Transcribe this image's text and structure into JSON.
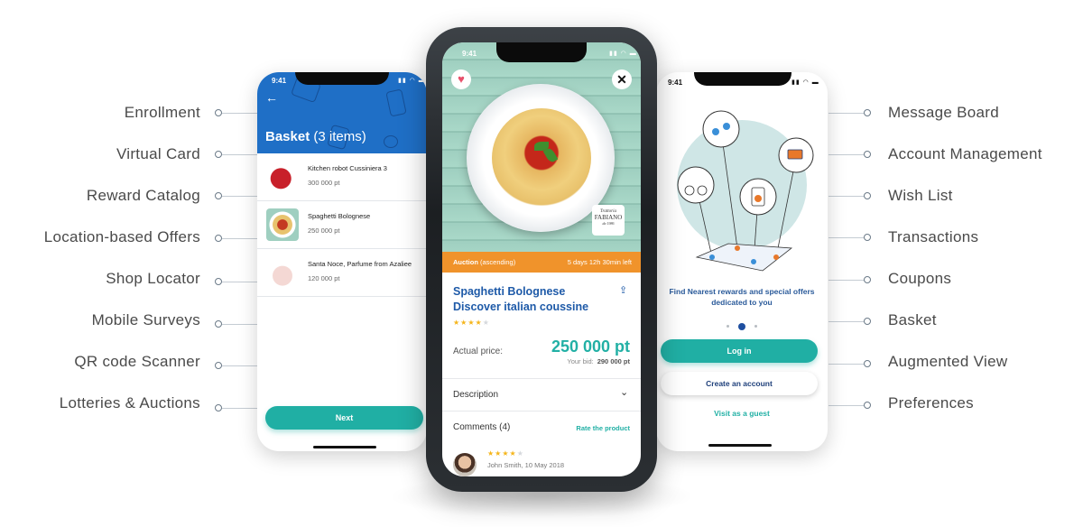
{
  "features_left": [
    "Enrollment",
    "Virtual Card",
    "Reward Catalog",
    "Location-based Offers",
    "Shop Locator",
    "Mobile Surveys",
    "QR code Scanner",
    "Lotteries & Auctions"
  ],
  "features_right": [
    "Message Board",
    "Account Management",
    "Wish List",
    "Transactions",
    "Coupons",
    "Basket",
    "Augmented View",
    "Preferences"
  ],
  "colors": {
    "primary_blue": "#1f6fc6",
    "teal": "#20afa4",
    "orange": "#f0932b",
    "title_blue": "#1e5aa8",
    "star": "#f5b51b"
  },
  "status_bar": {
    "time": "9:41",
    "icons": "signal wifi battery"
  },
  "basket_screen": {
    "back_icon": "arrow-left",
    "title": "Basket",
    "count": "(3 items)",
    "items": [
      {
        "name": "Kitchen robot Cussiniera 3",
        "price": "300 000 pt"
      },
      {
        "name": "Spaghetti Bolognese",
        "price": "250 000 pt"
      },
      {
        "name": "Santa Noce, Parfume from Azaliee",
        "price": "120 000 pt"
      }
    ],
    "next_label": "Next"
  },
  "product_screen": {
    "logo": {
      "line1": "Trattoria",
      "line2": "FABIANO",
      "line3": "da 1986"
    },
    "auction_type_bold": "Auction",
    "auction_type": "(ascending)",
    "time_left": "5 days 12h 30min left",
    "title_line1": "Spaghetti Bolognese",
    "title_line2": "Discover italian coussine",
    "rating": {
      "value": 4,
      "max": 5
    },
    "actual_price_label": "Actual price:",
    "actual_price": "250 000 pt",
    "your_bid_label": "Your bid:",
    "your_bid": "290 000 pt",
    "description_label": "Description",
    "comments_label": "Comments",
    "comments_count": "(4)",
    "rate_label": "Rate the product",
    "review": {
      "rating": 4,
      "author": "John Smith, 10  May 2018"
    }
  },
  "welcome_screen": {
    "tagline": "Find Nearest rewards and special offers dedicated to you",
    "pager": {
      "current": 2,
      "total": 3
    },
    "login_label": "Log in",
    "create_label": "Create an account",
    "guest_label": "Visit as a guest"
  }
}
